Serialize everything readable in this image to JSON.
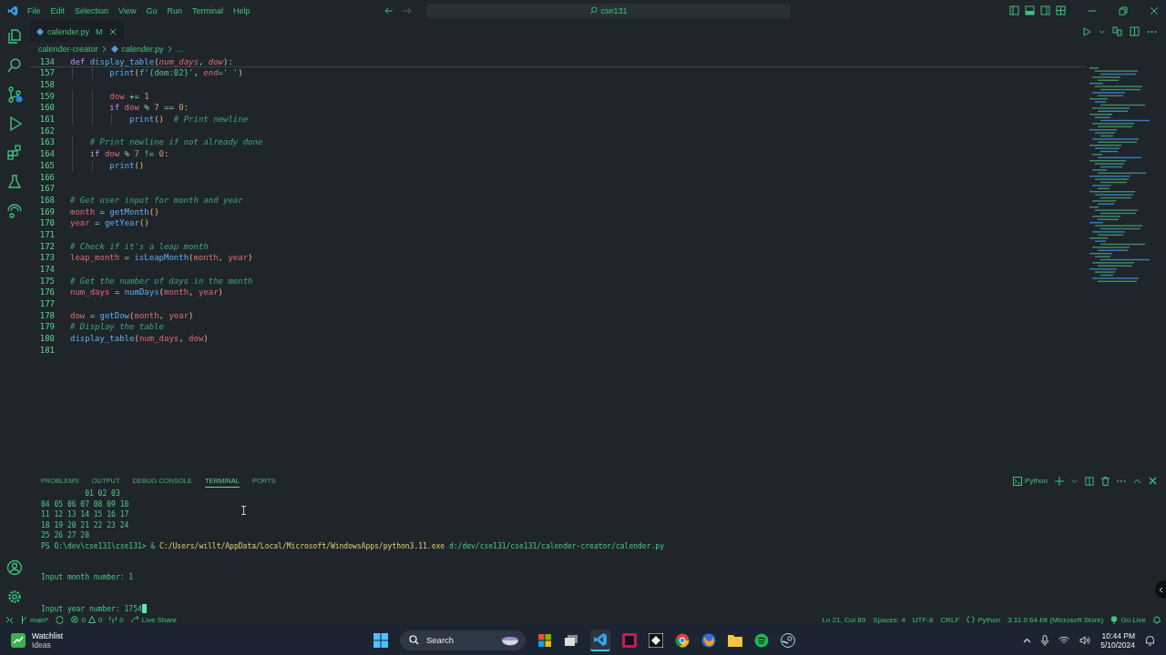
{
  "menu": [
    "File",
    "Edit",
    "Selection",
    "View",
    "Go",
    "Run",
    "Terminal",
    "Help"
  ],
  "search": {
    "value": "cse131"
  },
  "tabs": [
    {
      "label": "calender.py",
      "badge": "M",
      "selected": true
    }
  ],
  "breadcrumb": [
    "calender-creator",
    "calender.py",
    "..."
  ],
  "sticky_line": {
    "num": "134",
    "tokens": [
      {
        "t": "def ",
        "kind": "kw"
      },
      {
        "t": "display_table",
        "kind": "fn"
      },
      {
        "t": "(",
        "kind": "p"
      },
      {
        "t": "num_days",
        "kind": "param"
      },
      {
        "t": ", ",
        "kind": "op"
      },
      {
        "t": "dow",
        "kind": "param"
      },
      {
        "t": "):",
        "kind": "op"
      }
    ]
  },
  "code_lines": [
    {
      "num": "157",
      "tokens": [
        {
          "t": "        print",
          "kind": "fn"
        },
        {
          "t": "(",
          "kind": "p"
        },
        {
          "t": "f'{dom:02}'",
          "kind": "str"
        },
        {
          "t": ", ",
          "kind": "op"
        },
        {
          "t": "end",
          "kind": "param"
        },
        {
          "t": "=' '",
          "kind": "str"
        },
        {
          "t": ")",
          "kind": "p"
        }
      ]
    },
    {
      "num": "158"
    },
    {
      "num": "159",
      "tokens": [
        {
          "t": "        dow",
          "kind": "var"
        },
        {
          "t": " += ",
          "kind": "op"
        },
        {
          "t": "1",
          "kind": "num"
        }
      ]
    },
    {
      "num": "160",
      "tokens": [
        {
          "t": "        if ",
          "kind": "kw"
        },
        {
          "t": "dow",
          "kind": "var"
        },
        {
          "t": " % ",
          "kind": "op"
        },
        {
          "t": "7",
          "kind": "num"
        },
        {
          "t": " == ",
          "kind": "op"
        },
        {
          "t": "0",
          "kind": "num"
        },
        {
          "t": ":",
          "kind": "op"
        }
      ]
    },
    {
      "num": "161",
      "tokens": [
        {
          "t": "            print",
          "kind": "fn"
        },
        {
          "t": "()",
          "kind": "p"
        },
        {
          "t": "  # Print newline",
          "kind": "cm"
        }
      ]
    },
    {
      "num": "162"
    },
    {
      "num": "163",
      "tokens": [
        {
          "t": "    # Print newline if not already done",
          "kind": "cm"
        }
      ]
    },
    {
      "num": "164",
      "tokens": [
        {
          "t": "    if ",
          "kind": "kw"
        },
        {
          "t": "dow",
          "kind": "var"
        },
        {
          "t": " % ",
          "kind": "op"
        },
        {
          "t": "7",
          "kind": "num"
        },
        {
          "t": " != ",
          "kind": "op"
        },
        {
          "t": "0",
          "kind": "num"
        },
        {
          "t": ":",
          "kind": "op"
        }
      ]
    },
    {
      "num": "165",
      "tokens": [
        {
          "t": "        print",
          "kind": "fn"
        },
        {
          "t": "()",
          "kind": "p"
        }
      ]
    },
    {
      "num": "166"
    },
    {
      "num": "167"
    },
    {
      "num": "168",
      "tokens": [
        {
          "t": "# Get user input for month and year",
          "kind": "cm"
        }
      ]
    },
    {
      "num": "169",
      "tokens": [
        {
          "t": "month",
          "kind": "var"
        },
        {
          "t": " = ",
          "kind": "op"
        },
        {
          "t": "getMonth",
          "kind": "fn"
        },
        {
          "t": "()",
          "kind": "p"
        }
      ]
    },
    {
      "num": "170",
      "tokens": [
        {
          "t": "year",
          "kind": "var"
        },
        {
          "t": " = ",
          "kind": "op"
        },
        {
          "t": "getYear",
          "kind": "fn"
        },
        {
          "t": "()",
          "kind": "p"
        }
      ]
    },
    {
      "num": "171"
    },
    {
      "num": "172",
      "tokens": [
        {
          "t": "# Check if it's a leap month",
          "kind": "cm"
        }
      ]
    },
    {
      "num": "173",
      "tokens": [
        {
          "t": "leap_month",
          "kind": "var"
        },
        {
          "t": " = ",
          "kind": "op"
        },
        {
          "t": "isLeapMonth",
          "kind": "fn"
        },
        {
          "t": "(",
          "kind": "p"
        },
        {
          "t": "month",
          "kind": "var"
        },
        {
          "t": ", ",
          "kind": "op"
        },
        {
          "t": "year",
          "kind": "var"
        },
        {
          "t": ")",
          "kind": "p"
        }
      ]
    },
    {
      "num": "174"
    },
    {
      "num": "175",
      "tokens": [
        {
          "t": "# Get the number of days in the month",
          "kind": "cm"
        }
      ]
    },
    {
      "num": "176",
      "tokens": [
        {
          "t": "num_days",
          "kind": "var"
        },
        {
          "t": " = ",
          "kind": "op"
        },
        {
          "t": "numDays",
          "kind": "fn"
        },
        {
          "t": "(",
          "kind": "p"
        },
        {
          "t": "month",
          "kind": "var"
        },
        {
          "t": ", ",
          "kind": "op"
        },
        {
          "t": "year",
          "kind": "var"
        },
        {
          "t": ")",
          "kind": "p"
        }
      ]
    },
    {
      "num": "177"
    },
    {
      "num": "178",
      "tokens": [
        {
          "t": "dow",
          "kind": "var"
        },
        {
          "t": " = ",
          "kind": "op"
        },
        {
          "t": "getDow",
          "kind": "fn"
        },
        {
          "t": "(",
          "kind": "p"
        },
        {
          "t": "month",
          "kind": "var"
        },
        {
          "t": ", ",
          "kind": "op"
        },
        {
          "t": "year",
          "kind": "var"
        },
        {
          "t": ")",
          "kind": "p"
        }
      ]
    },
    {
      "num": "179",
      "tokens": [
        {
          "t": "# Display the table",
          "kind": "cm"
        }
      ]
    },
    {
      "num": "180",
      "tokens": [
        {
          "t": "display_table",
          "kind": "fn"
        },
        {
          "t": "(",
          "kind": "p"
        },
        {
          "t": "num_days",
          "kind": "var"
        },
        {
          "t": ", ",
          "kind": "op"
        },
        {
          "t": "dow",
          "kind": "var"
        },
        {
          "t": ")",
          "kind": "p"
        }
      ]
    },
    {
      "num": "181"
    }
  ],
  "panel_tabs": [
    {
      "label": "PROBLEMS",
      "selected": false
    },
    {
      "label": "OUTPUT",
      "selected": false
    },
    {
      "label": "DEBUG CONSOLE",
      "selected": false
    },
    {
      "label": "TERMINAL",
      "selected": true
    },
    {
      "label": "PORTS",
      "selected": false
    }
  ],
  "terminal_profile": "Python",
  "terminal": {
    "cursor_visible": true,
    "lines": [
      {
        "kind": "text",
        "segments": [
          {
            "t": "          01 02 03",
            "kind": "out"
          }
        ]
      },
      {
        "kind": "text",
        "segments": [
          {
            "t": "04 05 06 07 08 09 10",
            "kind": "out"
          }
        ]
      },
      {
        "kind": "text",
        "segments": [
          {
            "t": "11 12 13 14 15 16 17",
            "kind": "out"
          }
        ]
      },
      {
        "kind": "text",
        "segments": [
          {
            "t": "18 19 20 21 22 23 24",
            "kind": "out"
          }
        ]
      },
      {
        "kind": "text",
        "segments": [
          {
            "t": "25 26 27 28",
            "kind": "out"
          }
        ]
      },
      {
        "kind": "text",
        "segments": [
          {
            "t": "PS O:\\dev\\cse131\\cse131> & ",
            "kind": "out"
          },
          {
            "t": "C:/Users/willt/AppData/Local/Microsoft/WindowsApps/python3.11.exe",
            "kind": "cmd"
          },
          {
            "t": " d:/dev/cse131/cse131/calender-creator/calender.py",
            "kind": "out"
          }
        ]
      },
      {
        "kind": "blank"
      },
      {
        "kind": "blank"
      },
      {
        "kind": "text",
        "segments": [
          {
            "t": "Input month number: 1",
            "kind": "out"
          }
        ]
      },
      {
        "kind": "blank"
      },
      {
        "kind": "blank"
      },
      {
        "kind": "text",
        "segments": [
          {
            "t": "Input year number: 1754",
            "kind": "out"
          }
        ]
      }
    ]
  },
  "status_left": {
    "branch": "main*",
    "errors": "0",
    "warnings": "0",
    "ports": "0",
    "live_share": "Live Share"
  },
  "status_right": [
    "Ln 21, Col 89",
    "Spaces: 4",
    "UTF-8",
    "CRLF",
    "Python",
    "3.11.9 64-bit (Microsoft Store)",
    "Go Live"
  ],
  "taskbar": {
    "widget_title": "Watchlist",
    "widget_subtitle": "Ideas",
    "search": "Search",
    "time": "10:44 PM",
    "date": "5/10/2024"
  }
}
